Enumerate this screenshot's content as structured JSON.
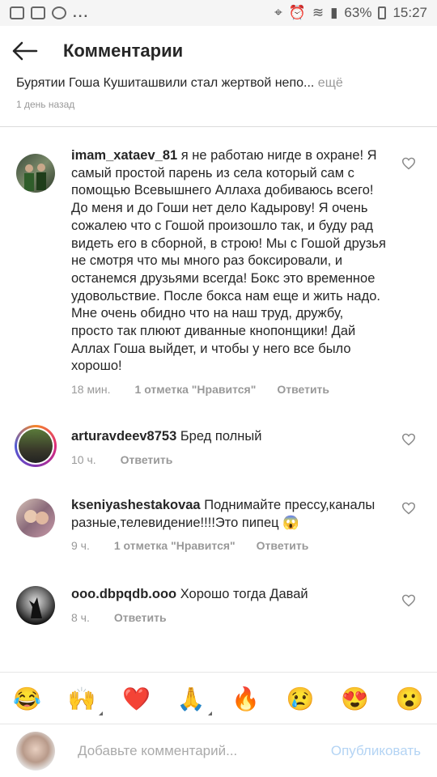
{
  "status": {
    "battery": "63%",
    "time": "15:27",
    "dots": "..."
  },
  "appbar": {
    "title": "Комментарии"
  },
  "caption": {
    "text": "Бурятии Гоша Кушиташвили стал жертвой непо...",
    "more": " ещё",
    "time": "1 день назад"
  },
  "comments": [
    {
      "username": "imam_xataev_81",
      "text": " я не работаю нигде в охране! Я самый простой парень из села который сам с помощью Всевышнего Аллаха добиваюсь всего! До меня и до Гоши нет дело Кадырову! Я очень сожалею что с Гошой произошло так, и буду рад видеть его в сборной, в строю! Мы с Гошой друзья не смотря что мы много раз боксировали, и останемся друзьями всегда! Бокс это временное удовольствие. После бокса нам еще и жить надо. Мне очень обидно что на наш труд, дружбу, просто так плюют диванные кнопонщики! Дай Аллах Гоша выйдет, и чтобы у него все было хорошо!",
      "time": "18 мин.",
      "likes": "1 отметка \"Нравится\"",
      "reply": "Ответить"
    },
    {
      "username": "arturavdeev8753",
      "text": " Бред полный",
      "time": "10 ч.",
      "likes": "",
      "reply": "Ответить"
    },
    {
      "username": "kseniyashestakovaa",
      "text": " Поднимайте прессу,каналы разные,телевидение!!!!Это пипец 😱",
      "time": "9 ч.",
      "likes": "1 отметка \"Нравится\"",
      "reply": "Ответить"
    },
    {
      "username": "ooo.dbpqdb.ooo",
      "text": " Хорошо тогда Давай",
      "time": "8 ч.",
      "likes": "",
      "reply": "Ответить"
    }
  ],
  "emojis": [
    "😂",
    "🙌",
    "❤️",
    "🙏",
    "🔥",
    "😢",
    "😍",
    "😮"
  ],
  "input": {
    "placeholder": "Добавьте комментарий...",
    "publish": "Опубликовать"
  }
}
